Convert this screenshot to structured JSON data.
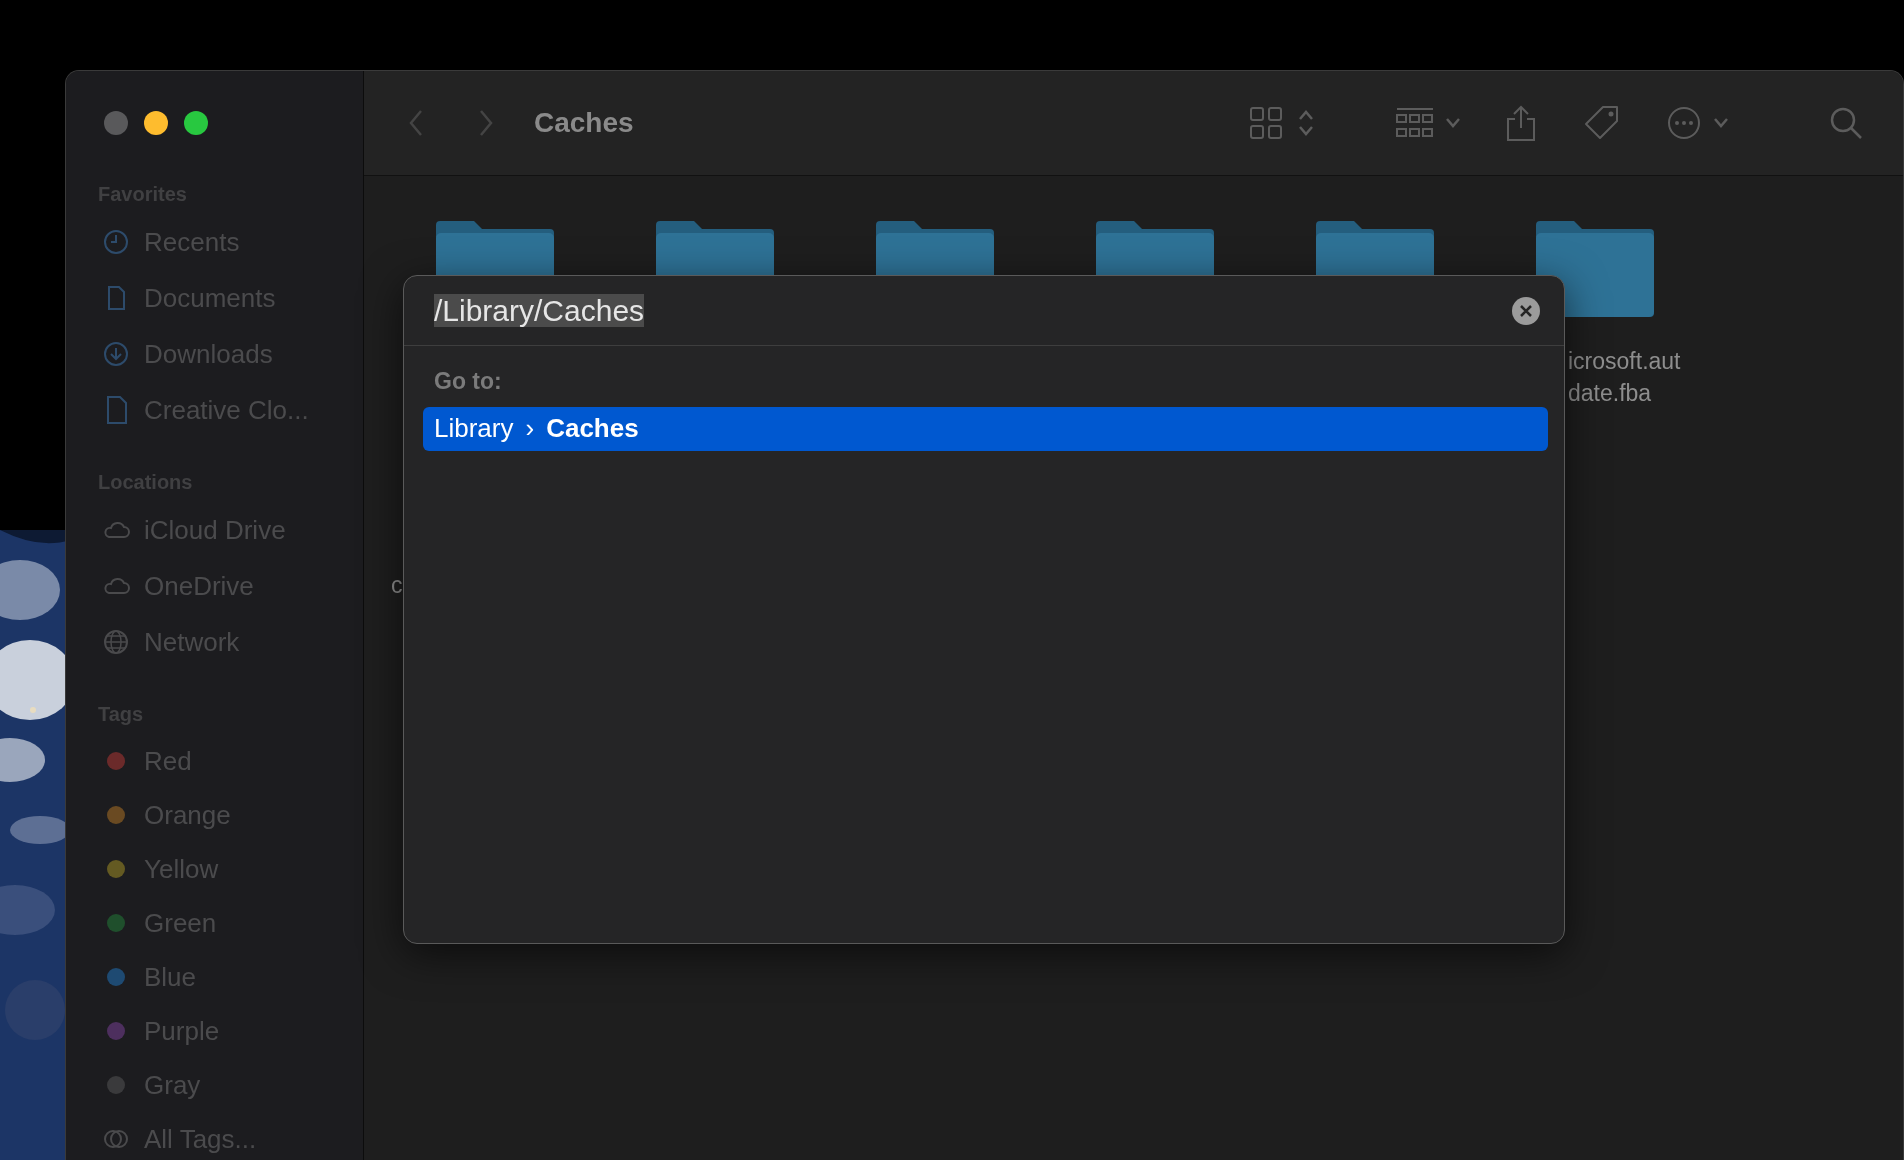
{
  "window": {
    "title": "Caches"
  },
  "sidebar": [
    {
      "heading": "Favorites",
      "kind": "places",
      "items": [
        {
          "label": "Recents"
        },
        {
          "label": "Documents"
        },
        {
          "label": "Downloads"
        },
        {
          "label": "Creative Clo..."
        }
      ]
    },
    {
      "heading": "Locations",
      "kind": "cloud",
      "items": [
        {
          "label": "iCloud Drive"
        },
        {
          "label": "OneDrive"
        },
        {
          "label": "Network"
        }
      ]
    },
    {
      "heading": "Tags",
      "kind": "tags",
      "items": [
        {
          "label": "Red",
          "color": "#6b2a2a"
        },
        {
          "label": "Orange",
          "color": "#6a4a22"
        },
        {
          "label": "Yellow",
          "color": "#645a22"
        },
        {
          "label": "Green",
          "color": "#1f4f2c"
        },
        {
          "label": "Blue",
          "color": "#1e4a72"
        },
        {
          "label": "Purple",
          "color": "#4d2f5e"
        },
        {
          "label": "Gray",
          "color": "#3a3a3c"
        },
        {
          "label": "All Tags..."
        }
      ]
    }
  ],
  "rows": [
    {
      "items": [
        {
          "kind": "folder"
        },
        {
          "kind": "folder"
        },
        {
          "kind": "folder"
        },
        {
          "kind": "folder"
        },
        {
          "kind": "folder"
        },
        {
          "kind": "folder",
          "label_lines": [
            "icrosoft.aut",
            "date.fba"
          ]
        }
      ]
    },
    {
      "items": [
        {
          "kind": "label",
          "label_lines": [
            "c"
          ]
        }
      ]
    }
  ],
  "go_to": {
    "query": "/Library/Caches",
    "heading": "Go to:",
    "results": [
      {
        "path": [
          "Library",
          "Caches"
        ],
        "separator": "›",
        "selected": true
      }
    ]
  }
}
